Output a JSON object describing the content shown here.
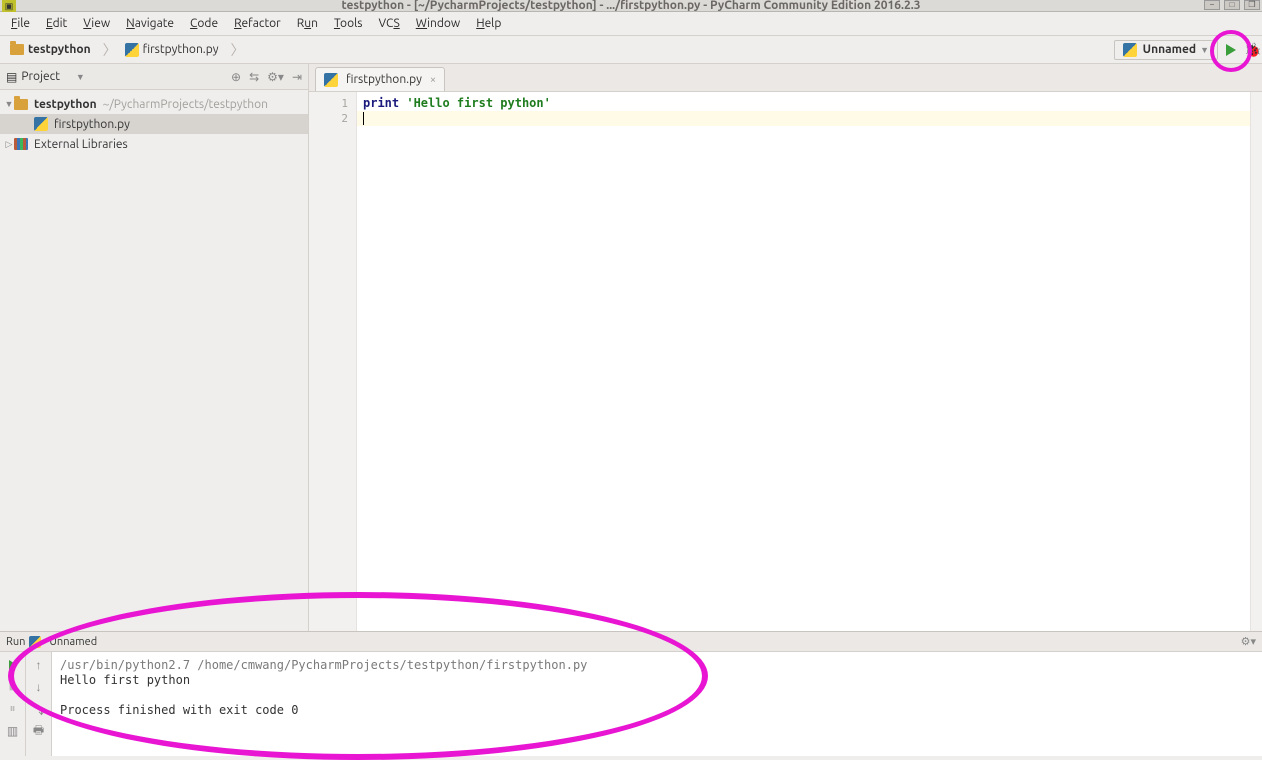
{
  "window": {
    "title": "testpython - [~/PycharmProjects/testpython] - .../firstpython.py - PyCharm Community Edition 2016.2.3"
  },
  "menu": [
    "File",
    "Edit",
    "View",
    "Navigate",
    "Code",
    "Refactor",
    "Run",
    "Tools",
    "VCS",
    "Window",
    "Help"
  ],
  "breadcrumb": {
    "project": "testpython",
    "file": "firstpython.py"
  },
  "runconfig": {
    "name": "Unnamed"
  },
  "project_panel": {
    "title": "Project",
    "root": {
      "name": "testpython",
      "path": "~/PycharmProjects/testpython"
    },
    "file": "firstpython.py",
    "external": "External Libraries"
  },
  "editor": {
    "tab": "firstpython.py",
    "code": {
      "line1_kw": "print",
      "line1_space": " ",
      "line1_str": "'Hello first python'"
    },
    "line_numbers": [
      "1",
      "2"
    ]
  },
  "run_window": {
    "label": "Run",
    "config": "Unnamed",
    "output": {
      "cmd": "/usr/bin/python2.7 /home/cmwang/PycharmProjects/testpython/firstpython.py",
      "stdout": "Hello first python",
      "exit": "Process finished with exit code 0"
    }
  }
}
